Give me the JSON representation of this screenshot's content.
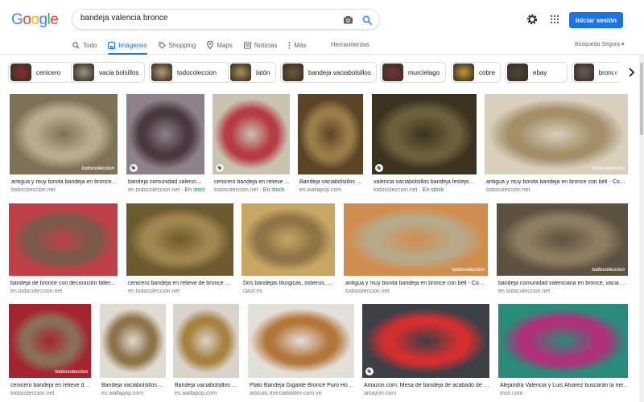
{
  "logo": {
    "text": "Google",
    "colors": [
      "#4285F4",
      "#EA4335",
      "#FBBC05",
      "#4285F4",
      "#34A853",
      "#EA4335"
    ]
  },
  "search": {
    "query": "bandeja valencia bronce"
  },
  "header": {
    "signin_label": "Iniciar sesión"
  },
  "tabs": [
    {
      "label": "Todo",
      "icon": "search-icon"
    },
    {
      "label": "Imágenes",
      "icon": "image-icon",
      "active": true
    },
    {
      "label": "Shopping",
      "icon": "tag-icon"
    },
    {
      "label": "Maps",
      "icon": "map-pin-icon"
    },
    {
      "label": "Noticias",
      "icon": "newspaper-icon"
    },
    {
      "label": "Más",
      "icon": "more-vert-icon"
    }
  ],
  "tools_label": "Herramientas",
  "safe_search_label": "Búsqueda Segura ▾",
  "chips": [
    {
      "label": "cenicero",
      "color": "#8b2a2f"
    },
    {
      "label": "vacia bolsillos",
      "color": "#9a9486"
    },
    {
      "label": "todocoleccion",
      "color": "#b79b6f"
    },
    {
      "label": "latón",
      "color": "#a89257"
    },
    {
      "label": "bandeja vaciabolsillos",
      "color": "#6e5a3a"
    },
    {
      "label": "murcielago",
      "color": "#7a3236"
    },
    {
      "label": "cobre",
      "color": "#c2952b"
    },
    {
      "label": "ebay",
      "color": "#4d4438"
    },
    {
      "label": "bronce vacia",
      "color": "#6b5a54"
    }
  ],
  "results": [
    {
      "caption": "antigua y muy bonita bandeja en bronce ...",
      "source": "todocoleccion.net",
      "stock": "",
      "color": "#b8ac8e",
      "accent": "#7d7256",
      "watermark": "todocoleccion",
      "badge": false
    },
    {
      "caption": "bandeja comunidad valenci...",
      "source": "en.todocoleccion.net",
      "stock": " · En stock",
      "color": "#4a3a40",
      "accent": "#8f8189",
      "watermark": "",
      "badge": true
    },
    {
      "caption": "cenicero bandeja en relieve ...",
      "source": "todocoleccion.net",
      "stock": " · En stock",
      "color": "#b73b45",
      "accent": "#c9c2b0",
      "watermark": "",
      "badge": true
    },
    {
      "caption": "Bandeja vaciabolsillos Bande...",
      "source": "es.wallapop.com",
      "stock": "",
      "color": "#9a7c48",
      "accent": "#5c4526",
      "watermark": "",
      "badge": false
    },
    {
      "caption": "valencia vaciabolsillos bandeja festejo...",
      "source": "todocoleccion.net",
      "stock": " · En stock",
      "color": "#6b603c",
      "accent": "#3b3320",
      "watermark": "",
      "badge": true
    },
    {
      "caption": "antigua y muy bonita bandeja en bronce con bell - Com...",
      "source": "todocoleccion.net",
      "stock": "",
      "color": "#a38e67",
      "accent": "#d8cfbd",
      "watermark": "todocoleccion",
      "badge": false
    },
    {
      "caption": "bandeja de bronce con decoración faller...",
      "source": "en.todocoleccion.net",
      "stock": "",
      "color": "#7a5a4b",
      "accent": "#c14048",
      "watermark": "",
      "badge": false
    },
    {
      "caption": "cenicero bandeja en relieve de bronce m...",
      "source": "en.todocoleccion.net",
      "stock": "",
      "color": "#a0874f",
      "accent": "#6d5a30",
      "watermark": "",
      "badge": false
    },
    {
      "caption": "Dos bandejas liturgicas, ostieros, ...",
      "source": "clasf.es",
      "stock": "",
      "color": "#8e7446",
      "accent": "#c9a664",
      "watermark": "",
      "badge": false
    },
    {
      "caption": "antigua y muy bonita bandeja en bronce con bell - Com...",
      "source": "todocoleccion.net",
      "stock": "",
      "color": "#b7a98a",
      "accent": "#d18d4d",
      "watermark": "todocoleccion",
      "badge": false
    },
    {
      "caption": "bandeja comunidad valenciana en bronce, vacia b...",
      "source": "en.todocoleccion.net",
      "stock": "",
      "color": "#8d7e61",
      "accent": "#5d5140",
      "watermark": "todocoleccion",
      "badge": false
    },
    {
      "caption": "cenicero bandeja en relieve de ...",
      "source": "todocoleccion.net",
      "stock": "",
      "color": "#8a6e5a",
      "accent": "#a5252f",
      "watermark": "todocoleccion",
      "badge": false
    },
    {
      "caption": "Bandeja vaciabolsillos ...",
      "source": "es.wallapop.com",
      "stock": "",
      "color": "#8d744b",
      "accent": "#e0dbd0",
      "watermark": "",
      "badge": false
    },
    {
      "caption": "Bandeja vaciabolsillos ...",
      "source": "es.wallapop.com",
      "stock": "",
      "color": "#a8823f",
      "accent": "#d8d4cc",
      "watermark": "",
      "badge": false
    },
    {
      "caption": "Plato Bandeja Gigante Bronce Puro Hoy...",
      "source": "articulo.mercadolibre.com.ve",
      "stock": "",
      "color": "#b3763b",
      "accent": "#e3dfd9",
      "watermark": "",
      "badge": false
    },
    {
      "caption": "Amazon.com: Mesa de bandeja de acabado de f...",
      "source": "amazon.com",
      "stock": "",
      "color": "#d32f2f",
      "accent": "#3c4046",
      "watermark": "",
      "badge": true
    },
    {
      "caption": "Alejandra Valencia y Luis Álvarez buscarán la me...",
      "source": "msn.com",
      "stock": "",
      "color": "#b0307a",
      "accent": "#2a8b7a",
      "watermark": "",
      "badge": false
    }
  ]
}
